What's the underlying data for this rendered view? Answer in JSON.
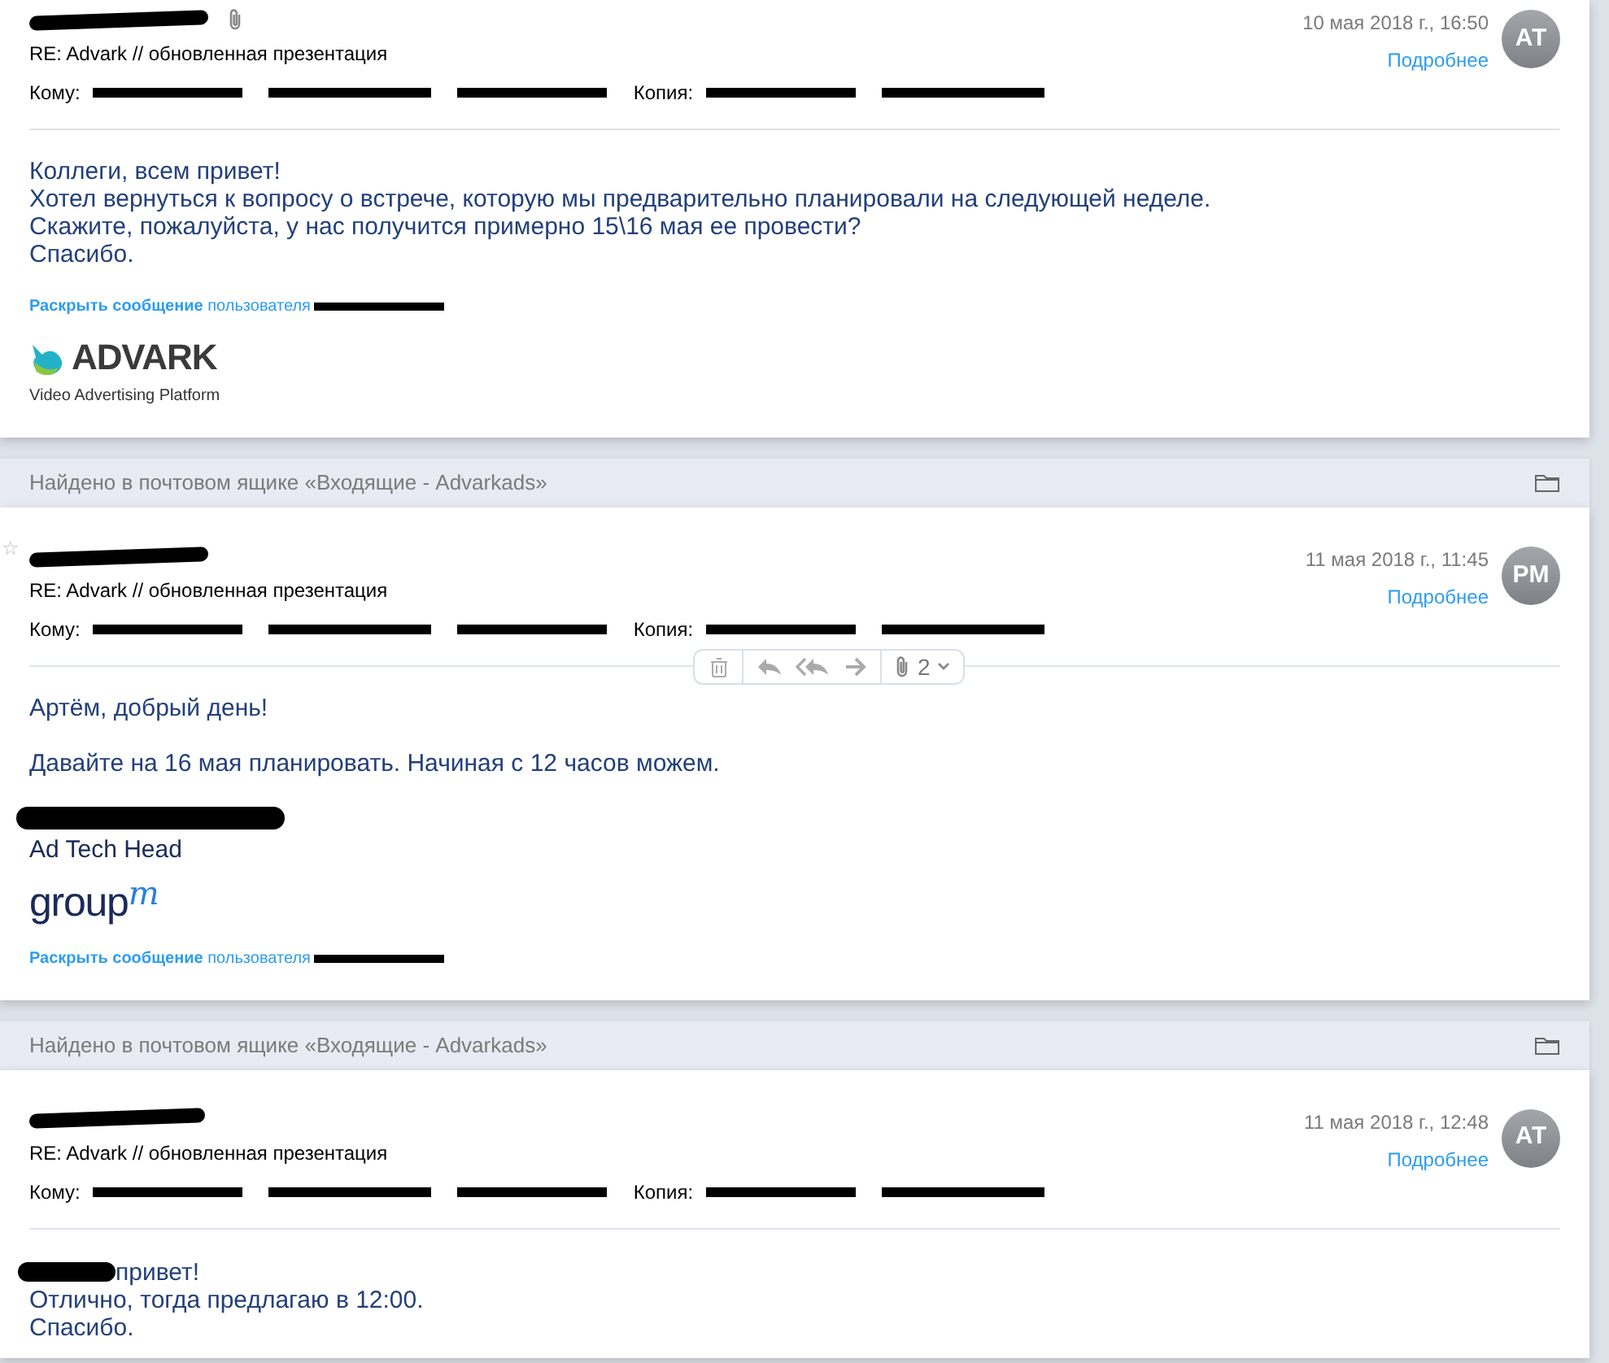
{
  "messages": [
    {
      "has_attachment": true,
      "date": "10 мая 2018 г., 16:50",
      "details_link": "Подробнее",
      "avatar": "АТ",
      "subject": "RE: Advark // обновленная презентация",
      "to_label": "Кому:",
      "to": [
        {
          "kind": "redacted"
        },
        {
          "kind": "redacted"
        },
        {
          "kind": "redacted"
        }
      ],
      "cc_label": "Копия:",
      "cc": [
        {
          "kind": "redacted"
        },
        {
          "kind": "redacted"
        }
      ],
      "body": [
        {
          "kind": "line",
          "text": "Коллеги, всем привет!"
        },
        {
          "kind": "line",
          "text": "Хотел вернуться к вопросу о встрече, которую мы предварительно планировали на следующей неделе."
        },
        {
          "kind": "line",
          "text": "Скажите, пожалуйста, у нас получится  примерно 15\\16 мая ее провести?"
        },
        {
          "kind": "line",
          "text": "Спасибо."
        }
      ],
      "expand_link": "**Раскрыть сообщение** пользователя",
      "logo": {
        "kind": "advark",
        "name": "ADVARK",
        "tagline": "Video Advertising Platform"
      }
    },
    {
      "found_in": "Найдено в почтовом ящике «Входящие - Advarkads»",
      "star": {
        "glyph": "☆",
        "selected": false
      },
      "date": "11 мая 2018 г., 11:45",
      "details_link": "Подробнее",
      "avatar": "PM",
      "subject": "RE: Advark // обновленная презентация",
      "to_label": "Кому:",
      "to": [
        {
          "kind": "redacted"
        },
        {
          "kind": "redacted"
        },
        {
          "kind": "redacted"
        }
      ],
      "cc_label": "Копия:",
      "cc": [
        {
          "kind": "redacted"
        },
        {
          "kind": "redacted"
        }
      ],
      "toolbar": {
        "attachments": "2"
      },
      "body": [
        {
          "kind": "line",
          "text": "Артём, добрый день!"
        },
        {
          "kind": "gap"
        },
        {
          "kind": "line",
          "text": "Давайте на 16 мая планировать. Начиная с 12 часов можем."
        }
      ],
      "signature": {
        "title": "Ad Tech Head"
      },
      "logo": {
        "kind": "groupm",
        "name": "group",
        "superscript": "m"
      },
      "expand_link": "**Раскрыть сообщение** пользователя"
    },
    {
      "found_in": "Найдено в почтовом ящике «Входящие - Advarkads»",
      "date": "11 мая 2018 г., 12:48",
      "details_link": "Подробнее",
      "avatar": "АТ",
      "subject": "RE: Advark // обновленная презентация",
      "to_label": "Кому:",
      "to": [
        {
          "kind": "redacted"
        },
        {
          "kind": "redacted"
        },
        {
          "kind": "redacted"
        }
      ],
      "cc_label": "Копия:",
      "cc": [
        {
          "kind": "redacted"
        },
        {
          "kind": "redacted"
        }
      ],
      "body": [
        {
          "kind": "redacted_start",
          "text": "привет!"
        },
        {
          "kind": "line",
          "text": "Отлично, тогда предлагаю в 12:00."
        },
        {
          "kind": "line",
          "text": "Спасибо."
        }
      ]
    }
  ]
}
